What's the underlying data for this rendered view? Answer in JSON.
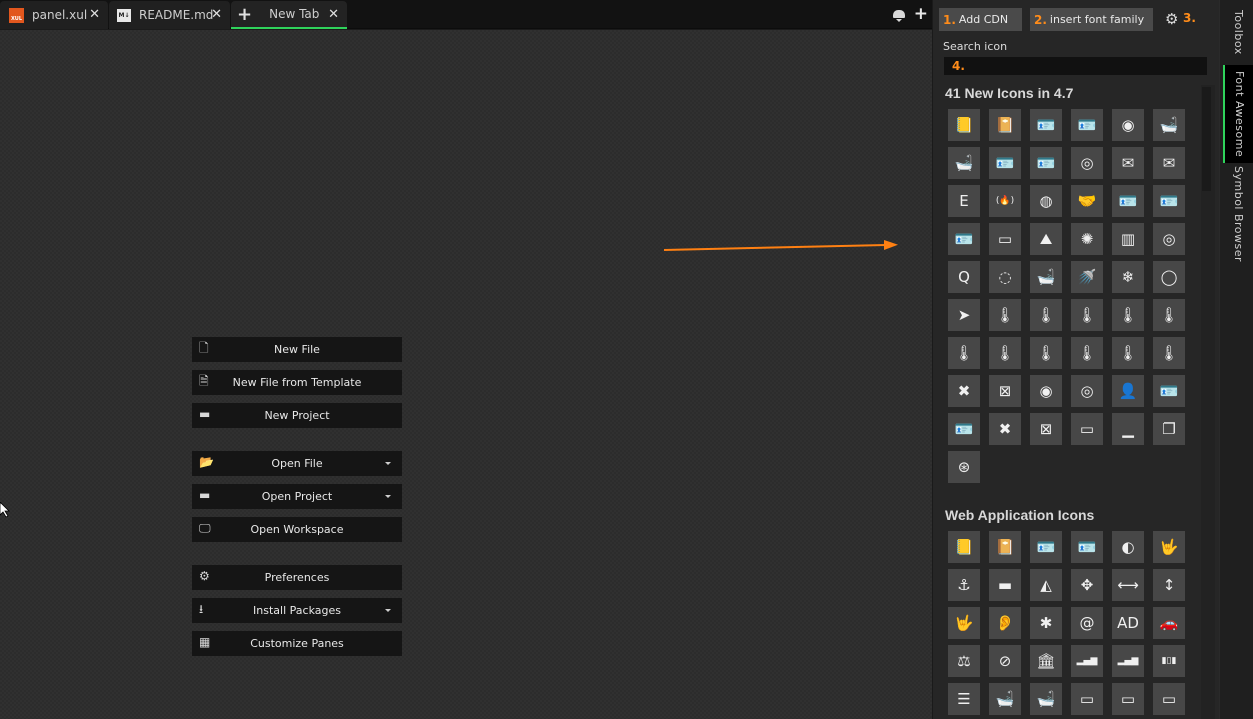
{
  "tabs": [
    {
      "label": "panel.xul",
      "icon": "xul-file-icon",
      "icon_text": "XUL",
      "active": false
    },
    {
      "label": "README.md",
      "icon": "markdown-file-icon",
      "icon_text": "M↓",
      "active": false
    },
    {
      "label": "New Tab",
      "icon": "plus-icon",
      "active": true
    }
  ],
  "tab_close_glyph": "✕",
  "tabbar_actions": [
    "notifications-icon",
    "new-tab-icon"
  ],
  "quick_start": [
    {
      "label": "New File",
      "icon": "new-file-icon",
      "glyph": "🗋",
      "dropdown": false
    },
    {
      "label": "New File from Template",
      "icon": "file-template-icon",
      "glyph": "🗎",
      "dropdown": false
    },
    {
      "label": "New Project",
      "icon": "archive-box-icon",
      "glyph": "▬",
      "dropdown": false
    },
    {
      "label": "Open File",
      "icon": "folder-open-icon",
      "glyph": "📂",
      "dropdown": true
    },
    {
      "label": "Open Project",
      "icon": "archive-box-icon",
      "glyph": "▬",
      "dropdown": true
    },
    {
      "label": "Open Workspace",
      "icon": "monitor-icon",
      "glyph": "🖵",
      "dropdown": false
    },
    {
      "label": "Preferences",
      "icon": "gear-icon",
      "glyph": "⚙",
      "dropdown": false
    },
    {
      "label": "Install Packages",
      "icon": "download-icon",
      "glyph": "⭳",
      "dropdown": true
    },
    {
      "label": "Customize Panes",
      "icon": "grid-icon",
      "glyph": "▦",
      "dropdown": false
    }
  ],
  "panel": {
    "add_cdn": {
      "num": "1.",
      "label": "Add CDN"
    },
    "insert_font": {
      "num": "2.",
      "label": "insert font family"
    },
    "settings_num": "3.",
    "search_label": "Search icon",
    "search_num": "4.",
    "accent": "#ff8c1a",
    "sections": [
      {
        "title": "41 New Icons in 4.7",
        "icons": [
          {
            "name": "address-book",
            "g": "📒"
          },
          {
            "name": "address-book-o",
            "g": "📔"
          },
          {
            "name": "address-card",
            "g": "🪪"
          },
          {
            "name": "address-card-o",
            "g": "🪪"
          },
          {
            "name": "bandcamp",
            "g": "◉"
          },
          {
            "name": "bath",
            "g": "🛁"
          },
          {
            "name": "bathtub",
            "g": "🛁"
          },
          {
            "name": "drivers-license",
            "g": "🪪"
          },
          {
            "name": "drivers-license-o",
            "g": "🪪"
          },
          {
            "name": "eercast",
            "g": "◎"
          },
          {
            "name": "envelope-open",
            "g": "✉"
          },
          {
            "name": "envelope-open-o",
            "g": "✉"
          },
          {
            "name": "etsy",
            "g": "E"
          },
          {
            "name": "free-code-camp",
            "g": "(🔥)"
          },
          {
            "name": "grav",
            "g": "◍"
          },
          {
            "name": "handshake-o",
            "g": "🤝"
          },
          {
            "name": "id-badge",
            "g": "🪪"
          },
          {
            "name": "id-card",
            "g": "🪪"
          },
          {
            "name": "id-card-o",
            "g": "🪪"
          },
          {
            "name": "imdb",
            "g": "▭"
          },
          {
            "name": "linode",
            "g": "⛰"
          },
          {
            "name": "meetup",
            "g": "✺"
          },
          {
            "name": "microchip",
            "g": "▥"
          },
          {
            "name": "podcast",
            "g": "◎"
          },
          {
            "name": "quora",
            "g": "Q"
          },
          {
            "name": "ravelry",
            "g": "◌"
          },
          {
            "name": "s15",
            "g": "🛁"
          },
          {
            "name": "shower",
            "g": "🚿"
          },
          {
            "name": "snowflake-o",
            "g": "❄"
          },
          {
            "name": "superpowers",
            "g": "◯"
          },
          {
            "name": "telegram",
            "g": "➤"
          },
          {
            "name": "thermometer",
            "g": "🌡"
          },
          {
            "name": "thermometer-0",
            "g": "🌡"
          },
          {
            "name": "thermometer-1",
            "g": "🌡"
          },
          {
            "name": "thermometer-2",
            "g": "🌡"
          },
          {
            "name": "thermometer-3",
            "g": "🌡"
          },
          {
            "name": "thermometer-4",
            "g": "🌡"
          },
          {
            "name": "thermometer-empty",
            "g": "🌡"
          },
          {
            "name": "thermometer-full",
            "g": "🌡"
          },
          {
            "name": "thermometer-half",
            "g": "🌡"
          },
          {
            "name": "thermometer-quarter",
            "g": "🌡"
          },
          {
            "name": "thermometer-three-quarters",
            "g": "🌡"
          },
          {
            "name": "times-rectangle",
            "g": "✖"
          },
          {
            "name": "times-rectangle-o",
            "g": "⊠"
          },
          {
            "name": "user-circle",
            "g": "◉"
          },
          {
            "name": "user-circle-o",
            "g": "◎"
          },
          {
            "name": "user-o",
            "g": "👤"
          },
          {
            "name": "vcard",
            "g": "🪪"
          },
          {
            "name": "vcard-o",
            "g": "🪪"
          },
          {
            "name": "window-close",
            "g": "✖"
          },
          {
            "name": "window-close-o",
            "g": "⊠"
          },
          {
            "name": "window-maximize",
            "g": "▭"
          },
          {
            "name": "window-minimize",
            "g": "▁"
          },
          {
            "name": "window-restore",
            "g": "❐"
          },
          {
            "name": "wpexplorer",
            "g": "⊛"
          }
        ]
      },
      {
        "title": "Web Application Icons",
        "icons": [
          {
            "name": "address-book",
            "g": "📒"
          },
          {
            "name": "address-book-o",
            "g": "📔"
          },
          {
            "name": "address-card",
            "g": "🪪"
          },
          {
            "name": "address-card-o",
            "g": "🪪"
          },
          {
            "name": "adjust",
            "g": "◐"
          },
          {
            "name": "american-sign-language-interpreting",
            "g": "🤟"
          },
          {
            "name": "anchor",
            "g": "⚓"
          },
          {
            "name": "archive",
            "g": "▬"
          },
          {
            "name": "area-chart",
            "g": "◭"
          },
          {
            "name": "arrows",
            "g": "✥"
          },
          {
            "name": "arrows-h",
            "g": "⟷"
          },
          {
            "name": "arrows-v",
            "g": "↕"
          },
          {
            "name": "asl-interpreting",
            "g": "🤟"
          },
          {
            "name": "assistive-listening-systems",
            "g": "👂"
          },
          {
            "name": "asterisk",
            "g": "✱"
          },
          {
            "name": "at",
            "g": "@"
          },
          {
            "name": "audio-description",
            "g": "AD"
          },
          {
            "name": "automobile",
            "g": "🚗"
          },
          {
            "name": "balance-scale",
            "g": "⚖"
          },
          {
            "name": "ban",
            "g": "⊘"
          },
          {
            "name": "bank",
            "g": "🏛"
          },
          {
            "name": "bar-chart",
            "g": "▂▄▆"
          },
          {
            "name": "bar-chart-o",
            "g": "▂▄▆"
          },
          {
            "name": "barcode",
            "g": "▮▯▮"
          },
          {
            "name": "bars",
            "g": "☰"
          },
          {
            "name": "bath",
            "g": "🛁"
          },
          {
            "name": "bathtub",
            "g": "🛁"
          },
          {
            "name": "battery",
            "g": "▭"
          },
          {
            "name": "battery-0",
            "g": "▭"
          },
          {
            "name": "battery-1",
            "g": "▭"
          }
        ]
      }
    ]
  },
  "side_tabs": [
    {
      "label": "Toolbox",
      "active": false
    },
    {
      "label": "Font Awesome",
      "active": true
    },
    {
      "label": "Symbol Browser",
      "active": false
    }
  ]
}
